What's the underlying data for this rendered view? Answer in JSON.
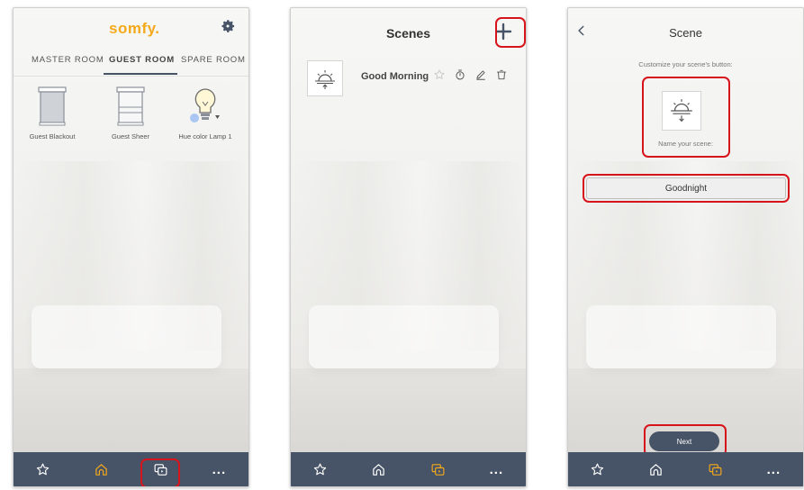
{
  "screen1": {
    "logo_text": "somfy.",
    "tabs": [
      {
        "label": "MASTER ROOM"
      },
      {
        "label": "GUEST ROOM",
        "active": true
      },
      {
        "label": "SPARE ROOM"
      }
    ],
    "devices": [
      {
        "label": "Guest Blackout",
        "icon": "blind-closed-icon"
      },
      {
        "label": "Guest Sheer",
        "icon": "blind-sheer-icon"
      },
      {
        "label": "Hue color Lamp 1",
        "icon": "lightbulb-icon"
      }
    ],
    "nav": [
      "favorites",
      "home",
      "scenes",
      "more"
    ],
    "active_nav": "home"
  },
  "screen2": {
    "title": "Scenes",
    "scenes": [
      {
        "name": "Good Morning",
        "icon": "sunrise-icon"
      }
    ],
    "active_nav": "scenes"
  },
  "screen3": {
    "title": "Scene",
    "subtitle": "Customize your scene's button:",
    "name_label": "Name your scene:",
    "name_value": "Goodnight",
    "next_label": "Next",
    "icon": "sunset-icon",
    "active_nav": "scenes"
  },
  "nav_more_label": "...",
  "colors": {
    "accent": "#f4a91a",
    "navbar": "#475467",
    "highlight": "#d7141b"
  }
}
